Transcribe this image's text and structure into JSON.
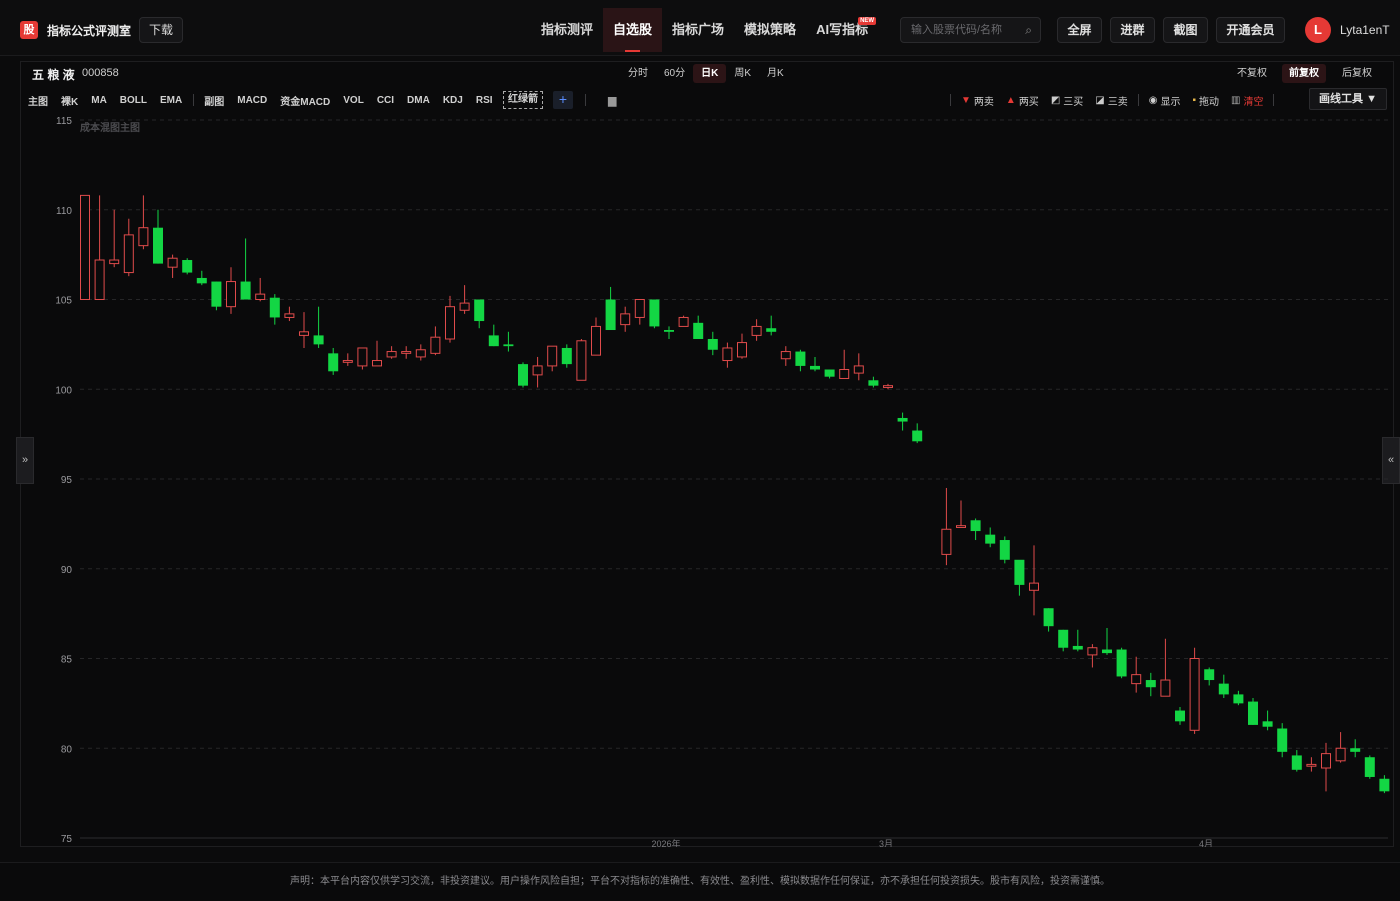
{
  "header": {
    "logo_char": "股",
    "brand": "指标公式评测室",
    "download": "下载",
    "nav": [
      {
        "label": "指标测评",
        "active": false
      },
      {
        "label": "自选股",
        "active": true
      },
      {
        "label": "指标广场",
        "active": false
      },
      {
        "label": "模拟策略",
        "active": false
      },
      {
        "label": "AI写指标",
        "active": false,
        "badge": "NEW"
      }
    ],
    "search_placeholder": "输入股票代码/名称",
    "buttons": [
      "全屏",
      "进群",
      "截图",
      "开通会员"
    ],
    "avatar_letter": "L",
    "username": "Lyta1enT"
  },
  "stock": {
    "name": "五 粮 液",
    "code": "000858"
  },
  "periods": [
    {
      "label": "分时",
      "active": false
    },
    {
      "label": "60分",
      "active": false
    },
    {
      "label": "日K",
      "active": true
    },
    {
      "label": "周K",
      "active": false
    },
    {
      "label": "月K",
      "active": false
    }
  ],
  "adjust": [
    {
      "label": "不复权",
      "active": false
    },
    {
      "label": "前复权",
      "active": true
    },
    {
      "label": "后复权",
      "active": false
    }
  ],
  "indicators": {
    "main_group": [
      "主图",
      "裸K",
      "MA",
      "BOLL",
      "EMA"
    ],
    "sub_group": [
      "副图",
      "MACD",
      "资金MACD",
      "VOL",
      "CCI",
      "DMA",
      "KDJ",
      "RSI"
    ],
    "dashed": "红绿箭",
    "plus": "+"
  },
  "right_tools": [
    {
      "icon": "down-triangle",
      "label": "两卖",
      "color": "#e53935"
    },
    {
      "icon": "up-triangle",
      "label": "两买",
      "color": "#e53935"
    },
    {
      "icon": "chart-icon",
      "label": "三买"
    },
    {
      "icon": "chart-icon",
      "label": "三卖"
    },
    {
      "icon": "eye",
      "label": "显示"
    },
    {
      "icon": "lock",
      "label": "拖动"
    },
    {
      "icon": "trash",
      "label": "清空",
      "color": "#e53935"
    }
  ],
  "draw_tools": "画线工具 ▼",
  "side_left": "»",
  "side_right": "«",
  "chart_data": {
    "type": "candlestick",
    "watermark": "成本混图主图",
    "y_ticks": [
      115,
      110,
      105,
      100,
      95,
      90,
      85,
      80,
      75
    ],
    "ylim": [
      75,
      115
    ],
    "x_labels": [
      "2026年",
      "3月",
      "4月"
    ],
    "up_color": "#e04b4b",
    "down_color": "#13d644",
    "candles": [
      [
        105,
        110.8,
        110.8,
        105
      ],
      [
        105,
        110.8,
        107.2,
        105
      ],
      [
        107,
        110,
        107.2,
        106.8
      ],
      [
        106.5,
        109.5,
        108.6,
        106.3
      ],
      [
        108,
        110.8,
        109,
        107.8
      ],
      [
        109,
        110,
        107,
        107
      ],
      [
        106.8,
        107.5,
        107.3,
        106.2
      ],
      [
        107.2,
        107.3,
        106.5,
        106.4
      ],
      [
        106.2,
        106.6,
        105.9,
        105.8
      ],
      [
        106,
        106,
        104.6,
        104.4
      ],
      [
        104.6,
        106.8,
        106,
        104.2
      ],
      [
        106,
        108.4,
        105,
        105
      ],
      [
        105,
        106.2,
        105.3,
        104.9
      ],
      [
        105.1,
        105.3,
        104,
        103.6
      ],
      [
        104,
        104.6,
        104.2,
        103.8
      ],
      [
        103,
        104.3,
        103.2,
        102.3
      ],
      [
        103,
        104.6,
        102.5,
        102.3
      ],
      [
        102,
        102.3,
        101,
        100.8
      ],
      [
        101.5,
        102,
        101.6,
        101.3
      ],
      [
        101.3,
        102.2,
        102.3,
        101.1
      ],
      [
        101.3,
        102.7,
        101.6,
        101.3
      ],
      [
        101.8,
        102.4,
        102.1,
        101.7
      ],
      [
        102,
        102.4,
        102.1,
        101.7
      ],
      [
        101.8,
        102.5,
        102.2,
        101.6
      ],
      [
        102,
        103.5,
        102.9,
        101.9
      ],
      [
        102.8,
        105.2,
        104.6,
        102.6
      ],
      [
        104.4,
        105.8,
        104.8,
        104.2
      ],
      [
        105,
        105,
        103.8,
        103.4
      ],
      [
        103,
        103.6,
        102.4,
        102.4
      ],
      [
        102.5,
        103.2,
        102.4,
        102.1
      ],
      [
        101.4,
        101.5,
        100.2,
        100.1
      ],
      [
        100.8,
        101.8,
        101.3,
        100.1
      ],
      [
        101.3,
        102.3,
        102.4,
        101
      ],
      [
        102.3,
        102.5,
        101.4,
        101.2
      ],
      [
        100.5,
        102.8,
        102.7,
        100.5
      ],
      [
        101.9,
        104,
        103.5,
        101.9
      ],
      [
        105,
        105.7,
        103.3,
        103.3
      ],
      [
        103.6,
        104.6,
        104.2,
        103.2
      ],
      [
        104,
        104.9,
        105,
        103.6
      ],
      [
        105,
        105,
        103.5,
        103.4
      ],
      [
        103.3,
        103.5,
        103.2,
        102.8
      ],
      [
        103.5,
        104.1,
        104,
        103.5
      ],
      [
        103.7,
        104.1,
        102.8,
        102.8
      ],
      [
        102.8,
        103.2,
        102.2,
        101.9
      ],
      [
        101.6,
        102.6,
        102.3,
        101.2
      ],
      [
        101.8,
        103.1,
        102.6,
        101.7
      ],
      [
        103,
        103.9,
        103.5,
        102.7
      ],
      [
        103.4,
        104.1,
        103.2,
        103
      ]
    ],
    "candles2": [
      [
        101.7,
        102.4,
        102.1,
        101.3
      ],
      [
        102.1,
        102.2,
        101.3,
        101
      ],
      [
        101.3,
        101.8,
        101.1,
        101
      ],
      [
        101.1,
        101.1,
        100.7,
        100.6
      ],
      [
        100.6,
        102.2,
        101.1,
        100.6
      ],
      [
        100.9,
        102,
        101.3,
        100.5
      ],
      [
        100.5,
        100.7,
        100.2,
        100.1
      ],
      [
        100.1,
        100.3,
        100.2,
        100
      ],
      [
        98.4,
        98.7,
        98.2,
        97.7
      ],
      [
        97.7,
        98.1,
        97.1,
        97
      ],
      [
        90.8,
        94.5,
        92.2,
        90.2
      ],
      [
        92.3,
        93.8,
        92.4,
        92.3
      ],
      [
        92.7,
        92.8,
        92.1,
        91.6
      ],
      [
        91.9,
        92.3,
        91.4,
        91.2
      ],
      [
        91.6,
        91.8,
        90.5,
        90.3
      ],
      [
        90.5,
        90.4,
        89.1,
        88.5
      ],
      [
        88.8,
        91.3,
        89.2,
        87.4
      ],
      [
        87.8,
        87.8,
        86.8,
        86.5
      ],
      [
        86.6,
        86.6,
        85.6,
        85.4
      ],
      [
        85.7,
        86.6,
        85.5,
        85.4
      ],
      [
        85.2,
        85.8,
        85.6,
        84.5
      ],
      [
        85.5,
        86.7,
        85.3,
        85.2
      ],
      [
        85.5,
        85.6,
        84,
        83.9
      ],
      [
        83.6,
        85.1,
        84.1,
        83.1
      ],
      [
        83.8,
        84.2,
        83.4,
        82.9
      ],
      [
        82.9,
        86.1,
        83.8,
        82.9
      ],
      [
        82.1,
        82.3,
        81.5,
        81.3
      ],
      [
        81,
        85.6,
        85,
        80.8
      ],
      [
        84.4,
        84.5,
        83.8,
        83.5
      ],
      [
        83.6,
        84.1,
        83,
        82.8
      ],
      [
        83,
        83.2,
        82.5,
        82.4
      ],
      [
        82.6,
        82.8,
        81.3,
        81.3
      ],
      [
        81.5,
        82.1,
        81.2,
        81
      ],
      [
        81.1,
        81.4,
        79.8,
        79.5
      ],
      [
        79.6,
        79.9,
        78.8,
        78.7
      ],
      [
        79,
        79.5,
        79.1,
        78.7
      ],
      [
        78.9,
        80.3,
        79.7,
        77.6
      ],
      [
        79.3,
        80.9,
        80,
        79.2
      ],
      [
        80,
        80.5,
        79.8,
        79.5
      ],
      [
        79.5,
        79.6,
        78.4,
        78.3
      ],
      [
        78.3,
        78.5,
        77.6,
        77.5
      ],
      [
        77.4,
        77.5,
        77.1,
        76.6
      ]
    ]
  },
  "footer": "声明：本平台内容仅供学习交流，非投资建议。用户操作风险自担；平台不对指标的准确性、有效性、盈利性、模拟数据作任何保证，亦不承担任何投资损失。股市有风险，投资需谨慎。"
}
